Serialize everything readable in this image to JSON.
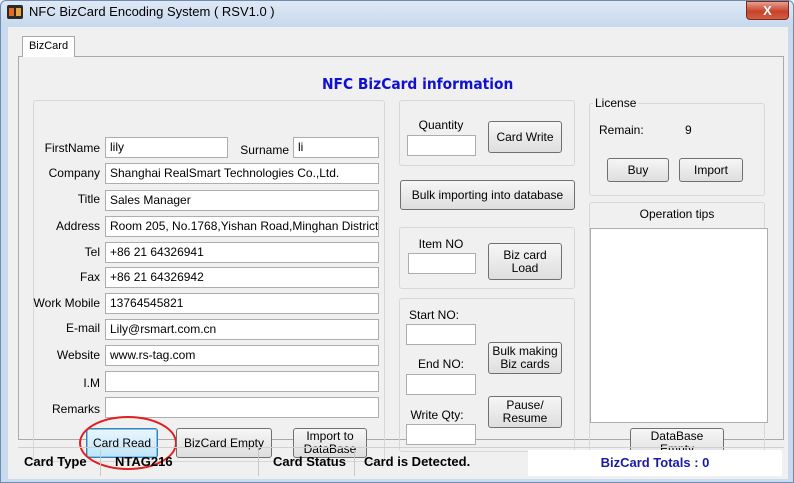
{
  "window": {
    "title": "NFC BizCard Encoding System ( RSV1.0 )",
    "close_label": "X"
  },
  "tab": {
    "label": "BizCard"
  },
  "heading": "NFC BizCard information",
  "form": {
    "firstname_label": "FirstName",
    "firstname_value": "lily",
    "surname_label": "Surname",
    "surname_value": "li",
    "company_label": "Company",
    "company_value": "Shanghai RealSmart Technologies Co.,Ltd.",
    "title_label": "Title",
    "title_value": "Sales Manager",
    "address_label": "Address",
    "address_value": "Room 205, No.1768,Yishan Road,Minghan District",
    "tel_label": "Tel",
    "tel_value": "+86 21 64326941",
    "fax_label": "Fax",
    "fax_value": "+86 21 64326942",
    "mobile_label": "Work Mobile",
    "mobile_value": "13764545821",
    "email_label": "E-mail",
    "email_value": "Lily@rsmart.com.cn",
    "website_label": "Website",
    "website_value": "www.rs-tag.com",
    "im_label": "I.M",
    "im_value": "",
    "remarks_label": "Remarks",
    "remarks_value": ""
  },
  "buttons": {
    "card_read": "Card Read",
    "bizcard_empty": "BizCard Empty",
    "import_to_database": "Import to DataBase",
    "card_write": "Card Write",
    "bulk_import": "Bulk importing into database",
    "biz_card_load": "Biz card Load",
    "bulk_making": "Bulk making Biz cards",
    "pause_resume": "Pause/ Resume",
    "buy": "Buy",
    "import": "Import",
    "database_empty": "DataBase Empty"
  },
  "write": {
    "quantity_label": "Quantity",
    "quantity_value": "",
    "item_no_label": "Item NO",
    "item_no_value": "",
    "start_no_label": "Start NO:",
    "start_no_value": "",
    "end_no_label": "End NO:",
    "end_no_value": "",
    "write_qty_label": "Write Qty:",
    "write_qty_value": ""
  },
  "license": {
    "title": "License",
    "remain_label": "Remain:",
    "remain_value": "9"
  },
  "tips": {
    "title": "Operation tips",
    "content": ""
  },
  "status": {
    "card_type_label": "Card Type",
    "card_type_value": "NTAG216",
    "card_status_label": "Card Status",
    "card_status_value": "Card is Detected.",
    "totals": "BizCard Totals : 0"
  },
  "colors": {
    "heading": "#1010d0",
    "totals": "#1a1aa8",
    "highlight": "#e02020"
  }
}
